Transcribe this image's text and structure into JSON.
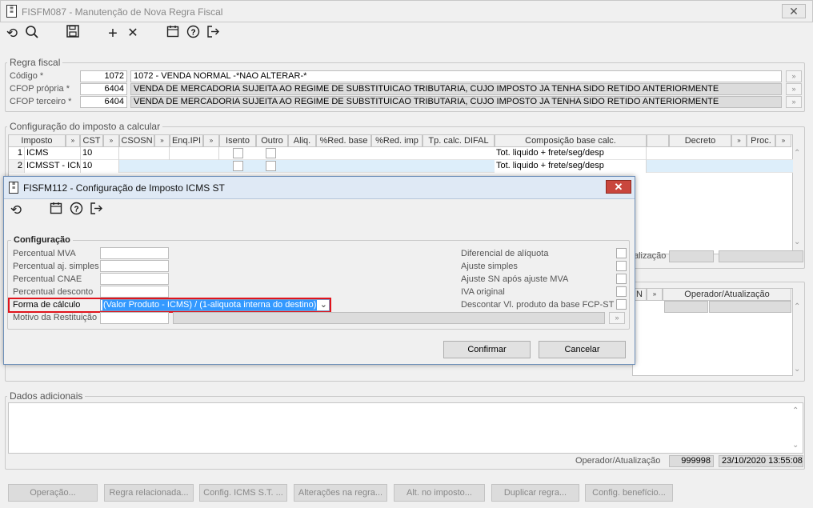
{
  "window": {
    "title": "FISFM087 - Manutenção de Nova Regra Fiscal",
    "close_glyph": "✕"
  },
  "toolbar": {
    "icons": [
      "refresh-icon",
      "search-icon",
      "save-icon",
      "add-icon",
      "delete-icon",
      "calendar-icon",
      "help-icon",
      "exit-icon"
    ]
  },
  "regra_fiscal": {
    "legend": "Regra fiscal",
    "codigo_label": "Código *",
    "codigo_value": "1072",
    "codigo_desc": "1072 - VENDA NORMAL -*NAO ALTERAR-*",
    "cfop_propria_label": "CFOP própria *",
    "cfop_propria_value": "6404",
    "cfop_propria_desc": "VENDA DE MERCADORIA SUJEITA AO REGIME DE SUBSTITUICAO TRIBUTARIA, CUJO IMPOSTO JA TENHA SIDO RETIDO ANTERIORMENTE",
    "cfop_terceiro_label": "CFOP terceiro *",
    "cfop_terceiro_value": "6404",
    "cfop_terceiro_desc": "VENDA DE MERCADORIA SUJEITA AO REGIME DE SUBSTITUICAO TRIBUTARIA, CUJO IMPOSTO JA TENHA SIDO RETIDO ANTERIORMENTE"
  },
  "configuracao_imposto": {
    "legend": "Configuração do imposto a calcular",
    "columns": [
      "Imposto",
      "CST",
      "CSOSN",
      "Enq.IPI",
      "Isento",
      "Outro",
      "Aliq.",
      "%Red. base",
      "%Red. imp",
      "Tp. calc. DIFAL",
      "Composição base calc.",
      "Decreto",
      "Proc."
    ],
    "rows": [
      {
        "num": "1",
        "imposto": "ICMS",
        "cst": "10",
        "composicao": "Tot. liquido + frete/seg/desp"
      },
      {
        "num": "2",
        "imposto": "ICMSST - ICMS",
        "cst": "10",
        "composicao": "Tot. liquido + frete/seg/desp"
      }
    ],
    "atualizacao_partial": "alização"
  },
  "second_grid": {
    "col_n": "N",
    "col_operador": "Operador/Atualização"
  },
  "dados_adicionais": {
    "legend": "Dados adicionais",
    "operador_label": "Operador/Atualização",
    "operador_value": "999998",
    "data_value": "23/10/2020 13:55:08"
  },
  "bottom_buttons": [
    "Operação...",
    "Regra relacionada...",
    "Config. ICMS S.T. ...",
    "Alterações na regra...",
    "Alt. no imposto...",
    "Duplicar regra...",
    "Config. benefício..."
  ],
  "dialog": {
    "title": "FISFM112 - Configuração de Imposto ICMS ST",
    "close_glyph": "✕",
    "legend": "Configuração",
    "percentual_mva_label": "Percentual MVA",
    "percentual_aj_simples_label": "Percentual aj. simples",
    "percentual_cnae_label": "Percentual CNAE",
    "percentual_desconto_label": "Percentual desconto",
    "forma_calculo_label": "Forma de cálculo",
    "forma_calculo_value": "(Valor Produto - ICMS) / (1-aliquota interna do destino)",
    "motivo_restituicao_label": "Motivo da Restituição",
    "diferencial_aliquota_label": "Diferencial de alíquota",
    "ajuste_simples_label": "Ajuste simples",
    "ajuste_sn_label": "Ajuste SN após ajuste MVA",
    "iva_original_label": "IVA original",
    "descontar_label": "Descontar Vl. produto da base FCP-ST",
    "confirmar_label": "Confirmar",
    "cancelar_label": "Cancelar"
  },
  "colors": {
    "highlight_border": "#e0141c",
    "selection_bg": "#3399ff",
    "row_selected": "#ddeefa"
  }
}
